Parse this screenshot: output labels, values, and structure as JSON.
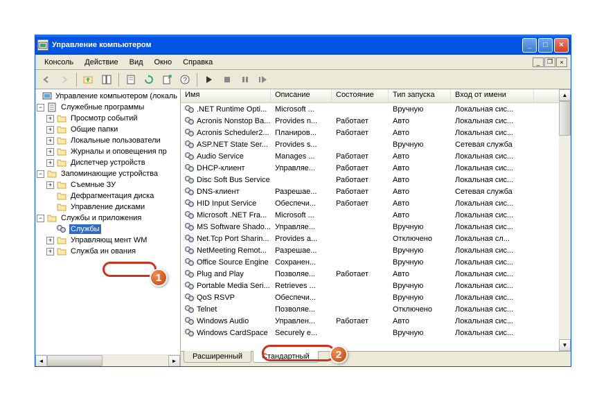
{
  "window": {
    "title": "Управление компьютером"
  },
  "menu": {
    "console": "Консоль",
    "action": "Действие",
    "view": "Вид",
    "window": "Окно",
    "help": "Справка"
  },
  "tree": {
    "root": "Управление компьютером (локаль",
    "g1": "Служебные программы",
    "g1_items": [
      "Просмотр событий",
      "Общие папки",
      "Локальные пользователи",
      "Журналы и оповещения пр",
      "Диспетчер устройств"
    ],
    "g2": "Запоминающие устройства",
    "g2_items": [
      "Съемные ЗУ",
      "Дефрагментация диска",
      "Управление дисками"
    ],
    "g3": "Службы и приложения",
    "g3_services": "Службы",
    "g3_wmi": "Управляющ           мент WM",
    "g3_index": "Служба ин            ования"
  },
  "columns": {
    "name": "Имя",
    "desc": "Описание",
    "state": "Состояние",
    "start": "Тип запуска",
    "logon": "Вход от имени"
  },
  "services": [
    {
      "name": ".NET Runtime Opti...",
      "desc": "Microsoft ...",
      "state": "",
      "start": "Вручную",
      "logon": "Локальная сис..."
    },
    {
      "name": "Acronis Nonstop Ba...",
      "desc": "Provides n...",
      "state": "Работает",
      "start": "Авто",
      "logon": "Локальная сис..."
    },
    {
      "name": "Acronis Scheduler2...",
      "desc": "Планиров...",
      "state": "Работает",
      "start": "Авто",
      "logon": "Локальная сис..."
    },
    {
      "name": "ASP.NET State Ser...",
      "desc": "Provides s...",
      "state": "",
      "start": "Вручную",
      "logon": "Сетевая служба"
    },
    {
      "name": "Audio Service",
      "desc": "Manages ...",
      "state": "Работает",
      "start": "Авто",
      "logon": "Локальная сис..."
    },
    {
      "name": "DHCP-клиент",
      "desc": "Управляе...",
      "state": "Работает",
      "start": "Авто",
      "logon": "Локальная сис..."
    },
    {
      "name": "Disc Soft Bus Service",
      "desc": "",
      "state": "Работает",
      "start": "Авто",
      "logon": "Локальная сис..."
    },
    {
      "name": "DNS-клиент",
      "desc": "Разрешае...",
      "state": "Работает",
      "start": "Авто",
      "logon": "Сетевая служба"
    },
    {
      "name": "HID Input Service",
      "desc": "Обеспечи...",
      "state": "Работает",
      "start": "Авто",
      "logon": "Локальная сис..."
    },
    {
      "name": "Microsoft .NET Fra...",
      "desc": "Microsoft ...",
      "state": "",
      "start": "Авто",
      "logon": "Локальная сис..."
    },
    {
      "name": "MS Software Shado...",
      "desc": "Управляе...",
      "state": "",
      "start": "Вручную",
      "logon": "Локальная сис..."
    },
    {
      "name": "Net.Tcp Port Sharin...",
      "desc": "Provides a...",
      "state": "",
      "start": "Отключено",
      "logon": "Локальная сл..."
    },
    {
      "name": "NetMeeting Remot...",
      "desc": "Разрешае...",
      "state": "",
      "start": "Вручную",
      "logon": "Локальная сис..."
    },
    {
      "name": "Office Source Engine",
      "desc": "Сохранен...",
      "state": "",
      "start": "Вручную",
      "logon": "Локальная сис..."
    },
    {
      "name": "Plug and Play",
      "desc": "Позволяе...",
      "state": "Работает",
      "start": "Авто",
      "logon": "Локальная сис..."
    },
    {
      "name": "Portable Media Seri...",
      "desc": "Retrieves ...",
      "state": "",
      "start": "Вручную",
      "logon": "Локальная сис..."
    },
    {
      "name": "QoS RSVP",
      "desc": "Обеспечи...",
      "state": "",
      "start": "Вручную",
      "logon": "Локальная сис..."
    },
    {
      "name": "Telnet",
      "desc": "Позволяе...",
      "state": "",
      "start": "Отключено",
      "logon": "Локальная сис..."
    },
    {
      "name": "Windows Audio",
      "desc": "Управлен...",
      "state": "Работает",
      "start": "Авто",
      "logon": "Локальная сис..."
    },
    {
      "name": "Windows CardSpace",
      "desc": "Securely e...",
      "state": "",
      "start": "Вручную",
      "logon": "Локальная сис..."
    }
  ],
  "tabs": {
    "extended": "Расширенный",
    "standard": "Стандартный"
  },
  "badges": {
    "one": "1",
    "two": "2"
  }
}
